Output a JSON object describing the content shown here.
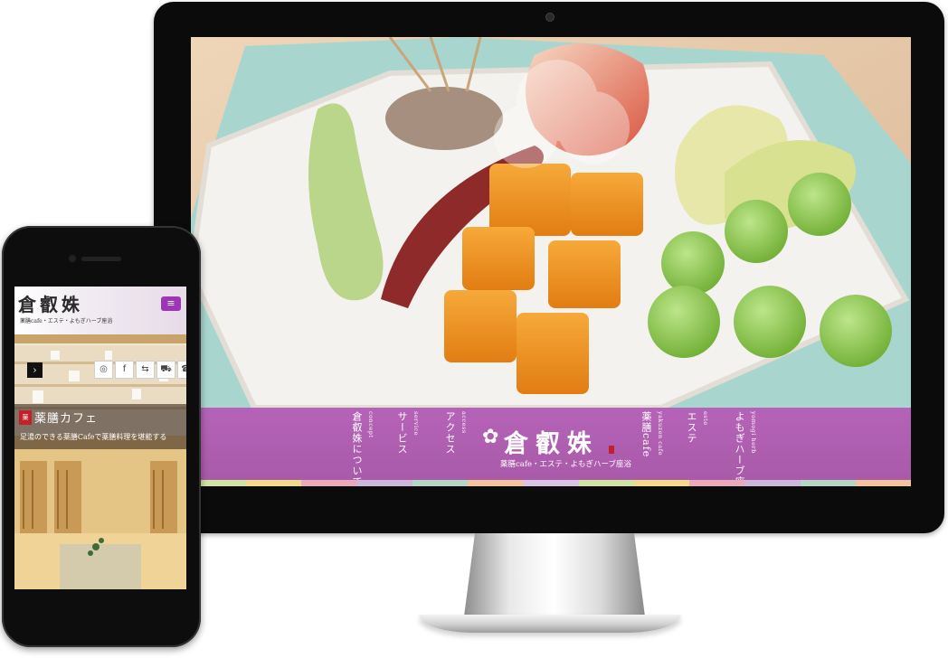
{
  "desktop": {
    "logo": {
      "mark": "✿",
      "title": "倉叡姝",
      "subtitle": "薬膳cafe・エステ・よもぎハーブ座浴"
    },
    "nav": [
      {
        "jp": "倉叡姝について",
        "en": "concept"
      },
      {
        "jp": "サービス",
        "en": "service"
      },
      {
        "jp": "アクセス",
        "en": "access"
      },
      {
        "jp": "薬膳cafe",
        "en": "yakuzen cafe"
      },
      {
        "jp": "エステ",
        "en": "este"
      },
      {
        "jp": "よもぎハーブ座浴",
        "en": "yomogi herb"
      }
    ],
    "stripe_colors": [
      "#cfe3a3",
      "#efd98a",
      "#e8a9b8",
      "#cbb7d8",
      "#b4d6c4",
      "#f3c49b",
      "#d7c3e2",
      "#cfe3a3",
      "#efd98a",
      "#e8a9b8",
      "#cbb7d8",
      "#b4d6c4",
      "#f3c49b"
    ]
  },
  "phone": {
    "logo": {
      "title": "倉叡姝",
      "subtitle": "薬膳cafe・エステ・よもぎハーブ座浴"
    },
    "menu_icon": "≡",
    "slider_arrow": "›",
    "social_icons": [
      {
        "name": "instagram-icon",
        "glyph": "◎"
      },
      {
        "name": "facebook-icon",
        "glyph": "f"
      },
      {
        "name": "handshake-icon",
        "glyph": "⇆"
      },
      {
        "name": "cart-icon",
        "glyph": "⛟"
      },
      {
        "name": "phone-icon",
        "glyph": "☎"
      }
    ],
    "caption": {
      "badge": "薬",
      "title": "薬膳カフェ",
      "text": "足湯のできる薬膳Cafeで薬膳料理を堪能する"
    }
  },
  "colors": {
    "purple": "#a95aa9",
    "menu_purple": "#9b36b4",
    "seal_red": "#c2202a"
  }
}
